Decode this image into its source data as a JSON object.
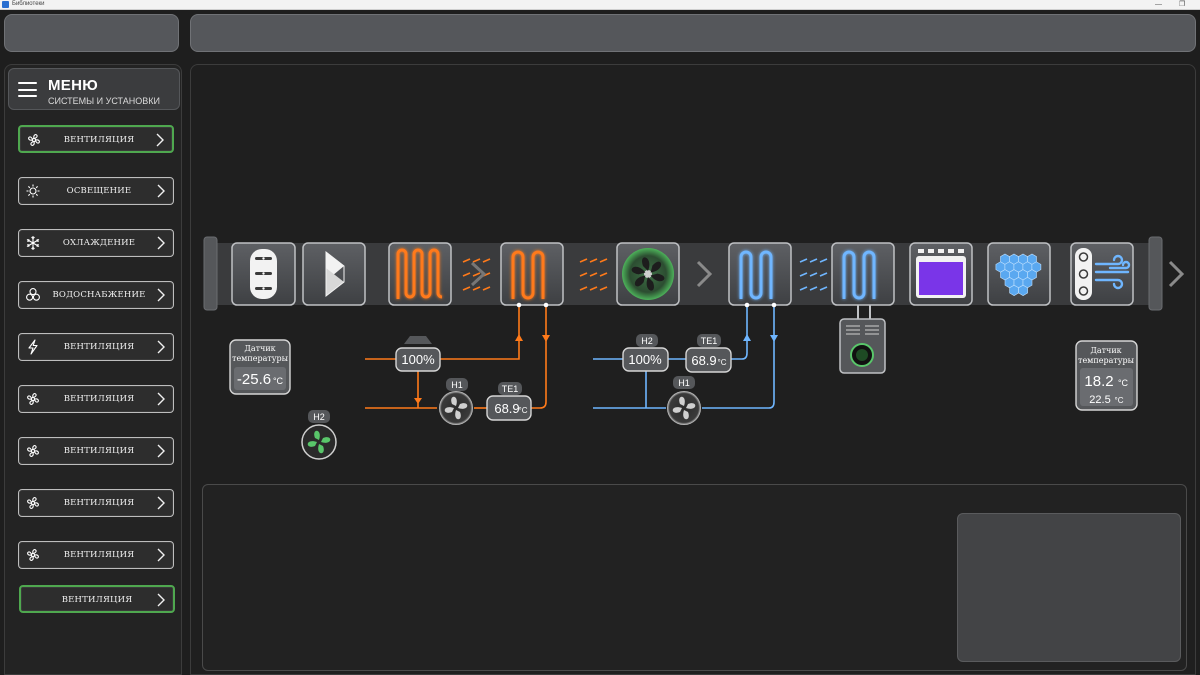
{
  "window": {
    "title": "Библиотеки",
    "minimize_glyph": "—",
    "restore_glyph": "❐"
  },
  "menu": {
    "title": "МЕНЮ",
    "subtitle": "СИСТЕМЫ И УСТАНОВКИ",
    "items": [
      {
        "label": "ВЕНТИЛЯЦИЯ",
        "icon": "fan-icon",
        "active": true
      },
      {
        "label": "ОСВЕЩЕНИЕ",
        "icon": "sun-icon",
        "active": false
      },
      {
        "label": "ОХЛАЖДЕНИЕ",
        "icon": "snowflake-icon",
        "active": false
      },
      {
        "label": "ВОДОСНАБЖЕНИЕ",
        "icon": "clover-icon",
        "active": false
      },
      {
        "label": "ВЕНТИЛЯЦИЯ",
        "icon": "lightning-icon",
        "active": false
      },
      {
        "label": "ВЕНТИЛЯЦИЯ",
        "icon": "fan-icon",
        "active": false
      },
      {
        "label": "ВЕНТИЛЯЦИЯ",
        "icon": "fan-icon",
        "active": false
      },
      {
        "label": "ВЕНТИЛЯЦИЯ",
        "icon": "fan-icon",
        "active": false
      },
      {
        "label": "ВЕНТИЛЯЦИЯ",
        "icon": "fan-icon",
        "active": false
      },
      {
        "label": "ВЕНТИЛЯЦИЯ",
        "icon": "none",
        "active": true
      }
    ]
  },
  "scheme": {
    "units": [
      {
        "name": "damper-unit",
        "icon": "damper-icon"
      },
      {
        "name": "filter-unit",
        "icon": "filter-icon"
      },
      {
        "name": "electric-heater-unit",
        "icon": "heater-coil-icon"
      },
      {
        "name": "water-heater-unit",
        "icon": "heater-coil-icon"
      },
      {
        "name": "supply-fan-unit",
        "icon": "fan-icon"
      },
      {
        "name": "cooler-unit-1",
        "icon": "cooling-coil-icon"
      },
      {
        "name": "cooler-unit-2",
        "icon": "cooling-coil-icon"
      },
      {
        "name": "uv-lamp-unit",
        "icon": "uv-lamp-icon"
      },
      {
        "name": "honeycomb-unit",
        "icon": "honeycomb-icon"
      },
      {
        "name": "silencer-unit",
        "icon": "silencer-icon"
      }
    ],
    "outdoor_sensor": {
      "label_line1": "Датчик",
      "label_line2": "температуры",
      "value": "-25.6",
      "unit": "°C"
    },
    "supply_sensor": {
      "label_line1": "Датчик",
      "label_line2": "температуры",
      "value": "18.2",
      "unit": "°C",
      "setpoint": "22.5",
      "setpoint_unit": "°C"
    },
    "heating_loop": {
      "valve_value": "100%",
      "pump_label": "H1",
      "temp_label": "TE1",
      "temp_value": "68.9",
      "temp_unit": "°C"
    },
    "cooling_loop": {
      "pump2_label": "H2",
      "valve_value": "100%",
      "temp_label": "TE1",
      "temp_value": "68.9",
      "temp_unit": "°C",
      "pump_label": "H1"
    },
    "standalone_pump_label": "H2",
    "colors": {
      "hot": "#ff7a1a",
      "cold": "#6fb6ff",
      "fan_green": "#59c66a",
      "uv_purple": "#7a35e8",
      "honeycomb_blue": "#5aa8f0",
      "active_green": "#4fa84f"
    }
  }
}
